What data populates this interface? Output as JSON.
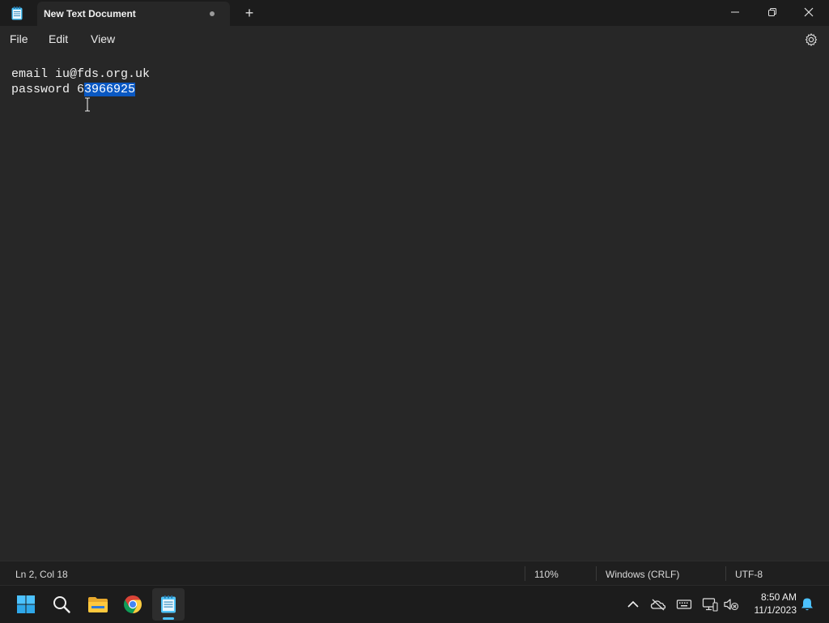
{
  "window": {
    "tab_title": "New Text Document",
    "new_tab_label": "+"
  },
  "menu": {
    "file": "File",
    "edit": "Edit",
    "view": "View"
  },
  "editor": {
    "line1": "email iu@fds.org.uk",
    "line2_before": "password 6",
    "line2_selected": "3966925"
  },
  "status": {
    "position": "Ln 2, Col 18",
    "zoom": "110%",
    "line_ending": "Windows (CRLF)",
    "encoding": "UTF-8"
  },
  "taskbar": {
    "pinned": [
      "start-icon",
      "search-icon",
      "file-explorer-icon",
      "chrome-icon",
      "notepad-icon"
    ],
    "tray": [
      "chevron-up-icon",
      "onedrive-off-icon",
      "keyboard-icon",
      "network-icon",
      "speaker-muted-icon",
      "notification-bell-icon"
    ],
    "time": "8:50 AM",
    "date": "11/1/2023"
  },
  "colors": {
    "selection": "#0a58c2",
    "accent": "#4cc2ff",
    "background": "#272727"
  }
}
